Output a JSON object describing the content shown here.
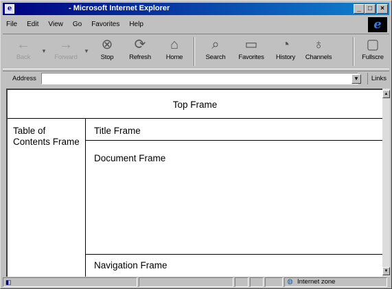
{
  "window": {
    "title": "- Microsoft Internet Explorer",
    "minimize": "_",
    "maximize": "□",
    "close": "×"
  },
  "menu": [
    "File",
    "Edit",
    "View",
    "Go",
    "Favorites",
    "Help"
  ],
  "toolbar": {
    "back": "Back",
    "forward": "Forward",
    "stop": "Stop",
    "refresh": "Refresh",
    "home": "Home",
    "search": "Search",
    "favorites": "Favorites",
    "history": "History",
    "channels": "Channels",
    "fullscreen": "Fullscre"
  },
  "address": {
    "label": "Address",
    "value": "",
    "links": "Links"
  },
  "frames": {
    "top": "Top Frame",
    "toc": "Table of Contents Frame",
    "title": "Title Frame",
    "document": "Document Frame",
    "navigation": "Navigation Frame"
  },
  "status": {
    "zone": "Internet zone"
  }
}
